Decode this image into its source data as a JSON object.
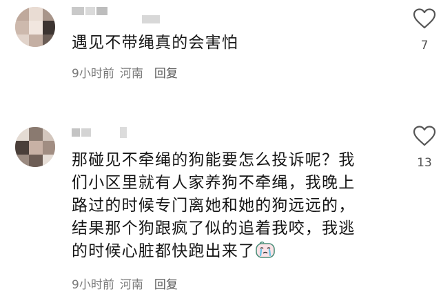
{
  "comments": [
    {
      "text_lines": [
        "遇见不带绳真的会害怕"
      ],
      "time": "9小时前",
      "location": "河南",
      "reply_label": "回复",
      "like_count": "7",
      "like_icon": "heart-outline-icon"
    },
    {
      "text_lines": [
        "那碰见不牵绳的狗能要怎么投诉呢？我",
        "们小区里就有人家养狗不牵绳，我晚上",
        "路过的时候专门离她和她的狗远远的，",
        "结果那个狗跟疯了似的追着我咬，我逃",
        "的时候心脏都快跑出来了"
      ],
      "emoji_icon": "crying-face-emoji-icon",
      "time": "9小时前",
      "location": "河南",
      "reply_label": "回复",
      "like_count": "13",
      "like_icon": "heart-outline-icon"
    }
  ],
  "colors": {
    "text": "#161616",
    "meta": "#7a7a7a",
    "icon": "#555555"
  }
}
